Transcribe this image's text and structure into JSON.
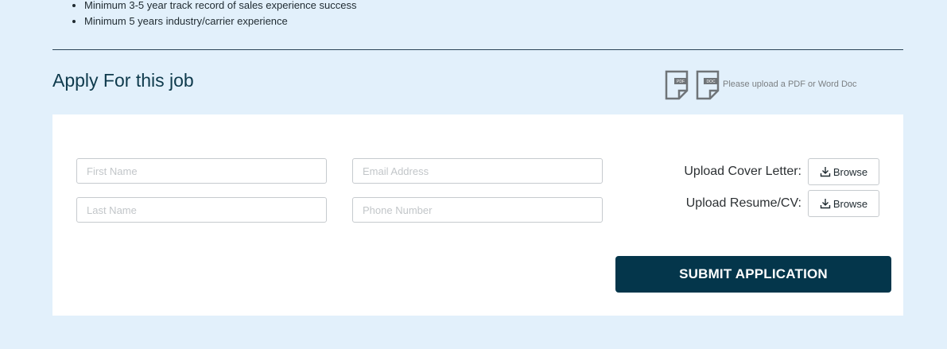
{
  "requirements": [
    "Minimum 3-5 year track record of sales experience success",
    "Minimum 5 years industry/carrier experience"
  ],
  "apply": {
    "title": "Apply For this job",
    "upload_hint": "Please upload a PDF or Word Doc",
    "icons": {
      "pdf": "pdf-document-icon",
      "pdf_label": "PDF",
      "doc": "word-document-icon",
      "doc_label": "DOC"
    }
  },
  "form": {
    "first_name_placeholder": "First Name",
    "last_name_placeholder": "Last Name",
    "email_placeholder": "Email Address",
    "phone_placeholder": "Phone Number",
    "cover_letter_label": "Upload Cover Letter:",
    "resume_label": "Upload Resume/CV:",
    "browse_label": "Browse",
    "browse_icon": "download-icon",
    "submit_label": "SUBMIT APPLICATION"
  },
  "colors": {
    "page_background": "#e2f0fb",
    "title": "#0e3a4c",
    "submit_background": "#04364b",
    "submit_text": "#ffffff"
  }
}
